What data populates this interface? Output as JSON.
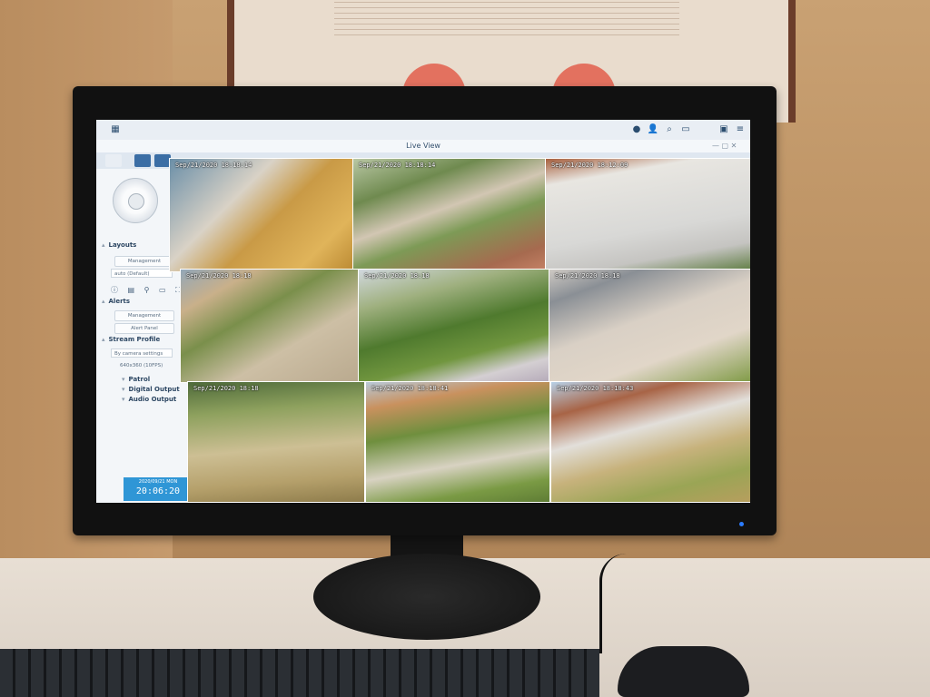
{
  "window": {
    "title": "Live View"
  },
  "sidebar": {
    "sections": {
      "layouts": "Layouts",
      "alerts": "Alerts",
      "stream_profile": "Stream Profile"
    },
    "layouts_management": "Management",
    "layout_select": "auto (Default)",
    "alerts_management": "Management",
    "alert_panel": "Alert Panel",
    "stream_select": "By camera settings",
    "stream_info": "640x360 (10FPS)",
    "collapsed": {
      "patrol": "Patrol",
      "digital_output": "Digital Output",
      "audio_output": "Audio Output"
    },
    "clock": {
      "date": "2020/09/21 MON",
      "time": "20:06:20"
    }
  },
  "cameras": [
    {
      "timestamp": "Sep/21/2020 18:18:14"
    },
    {
      "timestamp": "Sep/21/2020 18:18:14"
    },
    {
      "timestamp": "Sep/21/2020 18:12:09"
    },
    {
      "timestamp": "Sep/21/2020 18:18"
    },
    {
      "timestamp": "Sep/21/2020 18:18"
    },
    {
      "timestamp": "Sep/21/2020 18:18"
    },
    {
      "timestamp": "Sep/21/2020 18:18"
    },
    {
      "timestamp": "Sep/21/2020 18:18:41"
    },
    {
      "timestamp": "Sep/21/2020 18:18:43"
    }
  ],
  "colors": {
    "accent": "#2f96d6",
    "screen_bg": "#eef3f8",
    "sidebar_text": "#2d4763"
  }
}
